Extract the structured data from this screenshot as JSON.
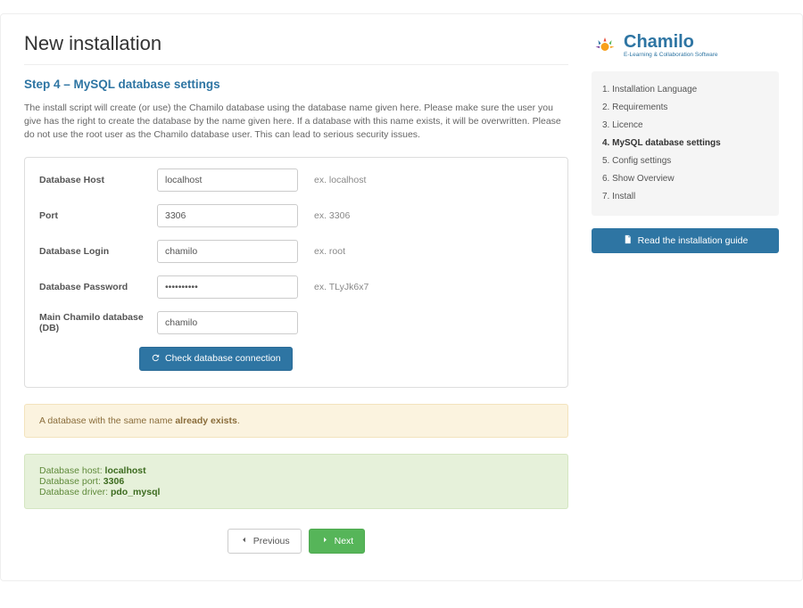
{
  "title": "New installation",
  "step_heading": "Step 4 – MySQL database settings",
  "intro": "The install script will create (or use) the Chamilo database using the database name given here. Please make sure the user you give has the right to create the database by the name given here. If a database with this name exists, it will be overwritten. Please do not use the root user as the Chamilo database user. This can lead to serious security issues.",
  "form": {
    "host": {
      "label": "Database Host",
      "value": "localhost",
      "hint": "ex. localhost"
    },
    "port": {
      "label": "Port",
      "value": "3306",
      "hint": "ex. 3306"
    },
    "login": {
      "label": "Database Login",
      "value": "chamilo",
      "hint": "ex. root"
    },
    "password": {
      "label": "Database Password",
      "value": "••••••••••",
      "hint": "ex. TLyJk6x7"
    },
    "dbname": {
      "label": "Main Chamilo database (DB)",
      "value": "chamilo",
      "hint": ""
    }
  },
  "check_button": "Check database connection",
  "warning": {
    "prefix": "A database with the same name ",
    "bold": "already exists",
    "suffix": "."
  },
  "result": {
    "host_label": "Database host: ",
    "host_value": "localhost",
    "port_label": "Database port: ",
    "port_value": "3306",
    "driver_label": "Database driver: ",
    "driver_value": "pdo_mysql"
  },
  "prev_button": "Previous",
  "next_button": "Next",
  "logo": {
    "name": "Chamilo",
    "tagline": "E-Learning & Collaboration Software"
  },
  "steps": [
    "1. Installation Language",
    "2. Requirements",
    "3. Licence",
    "4. MySQL database settings",
    "5. Config settings",
    "6. Show Overview",
    "7. Install"
  ],
  "active_step": 3,
  "guide_button": "Read the installation guide"
}
